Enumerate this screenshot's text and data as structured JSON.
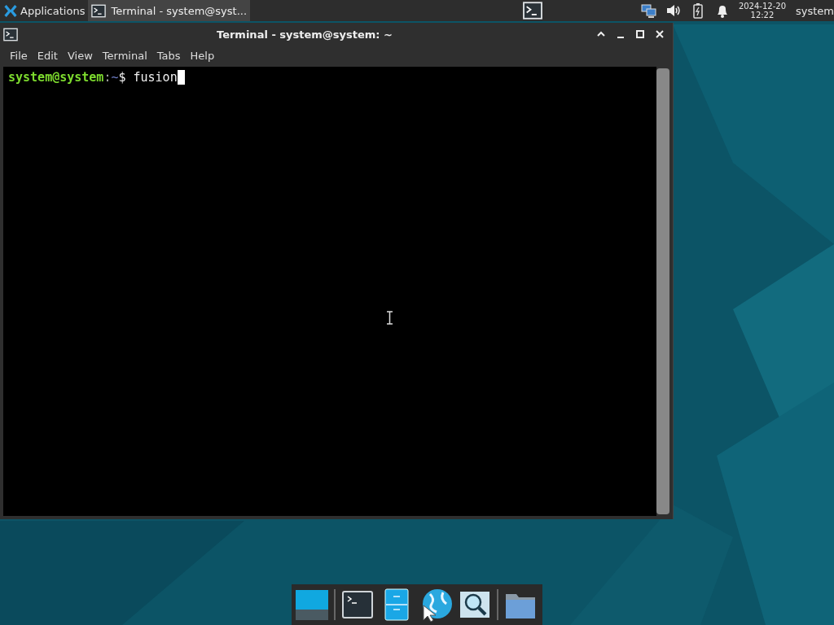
{
  "top_panel": {
    "applications_label": "Applications",
    "tasks": [
      {
        "title": "Terminal - system@syst...",
        "selected": true
      }
    ],
    "clock": {
      "date": "2024-12-20",
      "time": "12:22"
    },
    "user": "system"
  },
  "window": {
    "title": "Terminal - system@system: ~",
    "menu": [
      "File",
      "Edit",
      "View",
      "Terminal",
      "Tabs",
      "Help"
    ],
    "terminal": {
      "user_host": "system@system",
      "separator": ":",
      "path": "~",
      "prompt_symbol": "$",
      "command": "fusion"
    }
  },
  "dock": {
    "items": [
      {
        "kind": "desktop"
      },
      {
        "kind": "separator"
      },
      {
        "kind": "terminal"
      },
      {
        "kind": "files"
      },
      {
        "kind": "browser"
      },
      {
        "kind": "search"
      },
      {
        "kind": "separator"
      },
      {
        "kind": "folder"
      }
    ]
  }
}
